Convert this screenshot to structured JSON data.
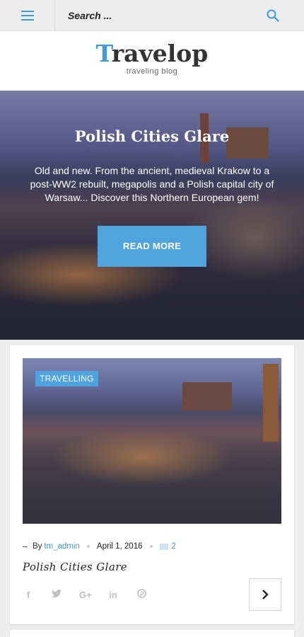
{
  "header": {
    "search_label": "Search ...",
    "menu_icon": "hamburger-menu-icon",
    "search_icon": "search-icon",
    "accent_color": "#3f9bd8"
  },
  "brand": {
    "logo_first": "T",
    "logo_rest": "ravelop",
    "tagline": "traveling blog"
  },
  "hero": {
    "title": "Polish Cities Glare",
    "description": "Old and new. From the ancient, medieval Krakow to a post-WW2 rebuilt, megapolis and a Polish capital city of Warsaw... Discover this Northern European gem!",
    "button_label": "READ MORE"
  },
  "post": {
    "category": "TRAVELLING",
    "by_label": "By",
    "author": "tm_admin",
    "date": "April 1, 2016",
    "comment_count": "2",
    "title": "Polish Cities Glare",
    "share": {
      "facebook": "f",
      "twitter": "twitter-icon",
      "google_plus": "G+",
      "linkedin": "in",
      "pinterest": "pinterest-icon"
    },
    "next_icon": "chevron-right-icon"
  }
}
